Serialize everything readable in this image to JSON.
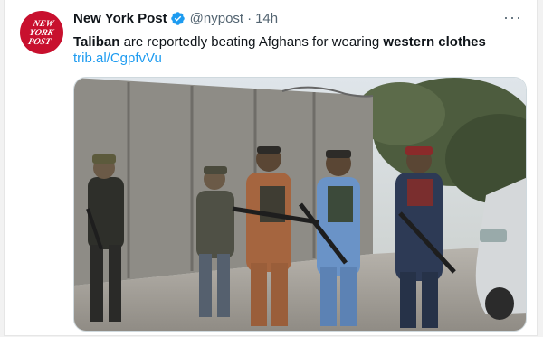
{
  "tweet": {
    "display_name": "New York Post",
    "handle": "@nypost",
    "separator": "·",
    "timestamp": "14h",
    "text_part1": "Taliban",
    "text_part2": " are reportedly beating Afghans for wearing ",
    "text_part3": "western clothes",
    "link": "trib.al/CgpfvVu",
    "more_label": "···"
  },
  "avatar": {
    "logo_line1": "NEW",
    "logo_line2": "YORK",
    "logo_line3": "POST"
  },
  "icons": {
    "verified": "verified-badge-icon",
    "more": "more-options-icon"
  },
  "colors": {
    "brand": "#c8102e",
    "verified": "#1d9bf0",
    "link": "#1d9bf0"
  },
  "media": {
    "description": ""
  }
}
